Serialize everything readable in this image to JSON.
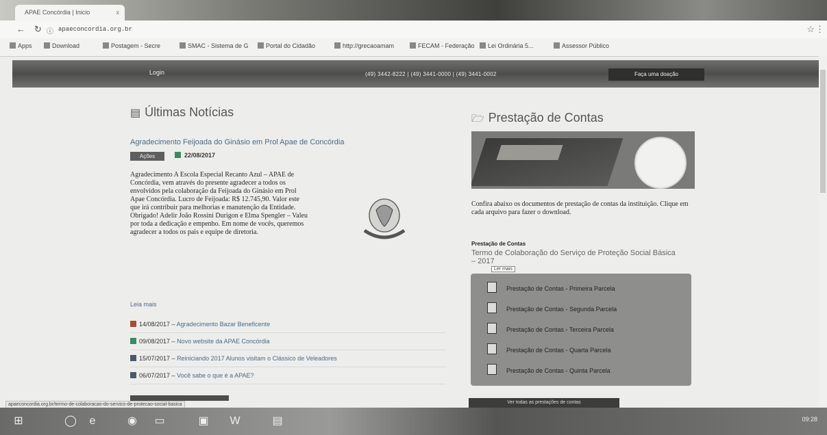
{
  "browser": {
    "tab_title": "APAE Concórdia | Inicio",
    "tab_close": "x",
    "url": "apaeconcordia.org.br",
    "bookmarks": [
      "Apps",
      "Download",
      "Postagem - Secre",
      "SMAC - Sistema de G",
      "Portal do Cidadão",
      "http://grecaoamam",
      "FECAM - Federação",
      "Lei Ordinária 5... ",
      "Assessor Público"
    ]
  },
  "site": {
    "login": "Login",
    "phones": "(49) 3442-8222 | (49) 3441-0000 | (49) 3441-0002",
    "donate_btn": "Faça uma doação"
  },
  "news": {
    "heading": "Últimas Notícias",
    "featured_title": "Agradecimento Feijoada do Ginásio em Prol Apae de Concórdia",
    "category": "Ações",
    "date": "22/08/2017",
    "body": "Agradecimento    A Escola Especial Recanto Azul – APAE de Concórdia, vem através do presente agradecer a todos os envolvidos pela colaboração da Feijoada do Ginásio em Prol Apae Concórdia. Lucro de Feijoada: R$ 12.745,90. Valor este que irá contribuir para melhorias e manutenção da Entidade. Obrigado! Adelir João Rossini Durigon e Elma Spengler – Valeu por toda a dedicação e empenho. Em nome de vocês, queremos agradecer a todos os pais e equipe de diretoria.",
    "read_more": "Leia mais",
    "items": [
      {
        "date": "14/08/2017",
        "title": "Agradecimento Bazar Beneficente",
        "color": "#a84a3a"
      },
      {
        "date": "09/08/2017",
        "title": "Novo website da APAE Concórdia",
        "color": "#3a8a66"
      },
      {
        "date": "15/07/2017",
        "title": "Reiniciando 2017 Alunos visitam o Clássico de Veleadores",
        "color": "#4a5a6a"
      },
      {
        "date": "06/07/2017",
        "title": "Você sabe o que é a APAE?",
        "color": "#4a5a6a"
      }
    ]
  },
  "accounts": {
    "heading": "Prestação de Contas",
    "description": "Confira abaixo os documentos de prestação de contas da instituição. Clique em cada arquivo para fazer o download.",
    "subheading": "Prestação de Contas",
    "term": "Termo de Colaboração do Serviço de Proteção Social Básica – 2017",
    "tooltip": "Ler mais",
    "documents": [
      "Prestação de Contas - Primeira Parcela",
      "Prestação de Contas - Segunda Parcela",
      "Prestação de Contas - Terceira Parcela",
      "Prestação de Contas - Quarta Parcela",
      "Prestação de Contas - Quinta Parcela"
    ],
    "all_btn": "Ver todas as prestações de contas"
  },
  "statusbar": "apaeconcordia.org.br/termo-de-colaboracao-do-servico-de-protecao-social-basica",
  "taskbar": {
    "clock": "09:28"
  }
}
